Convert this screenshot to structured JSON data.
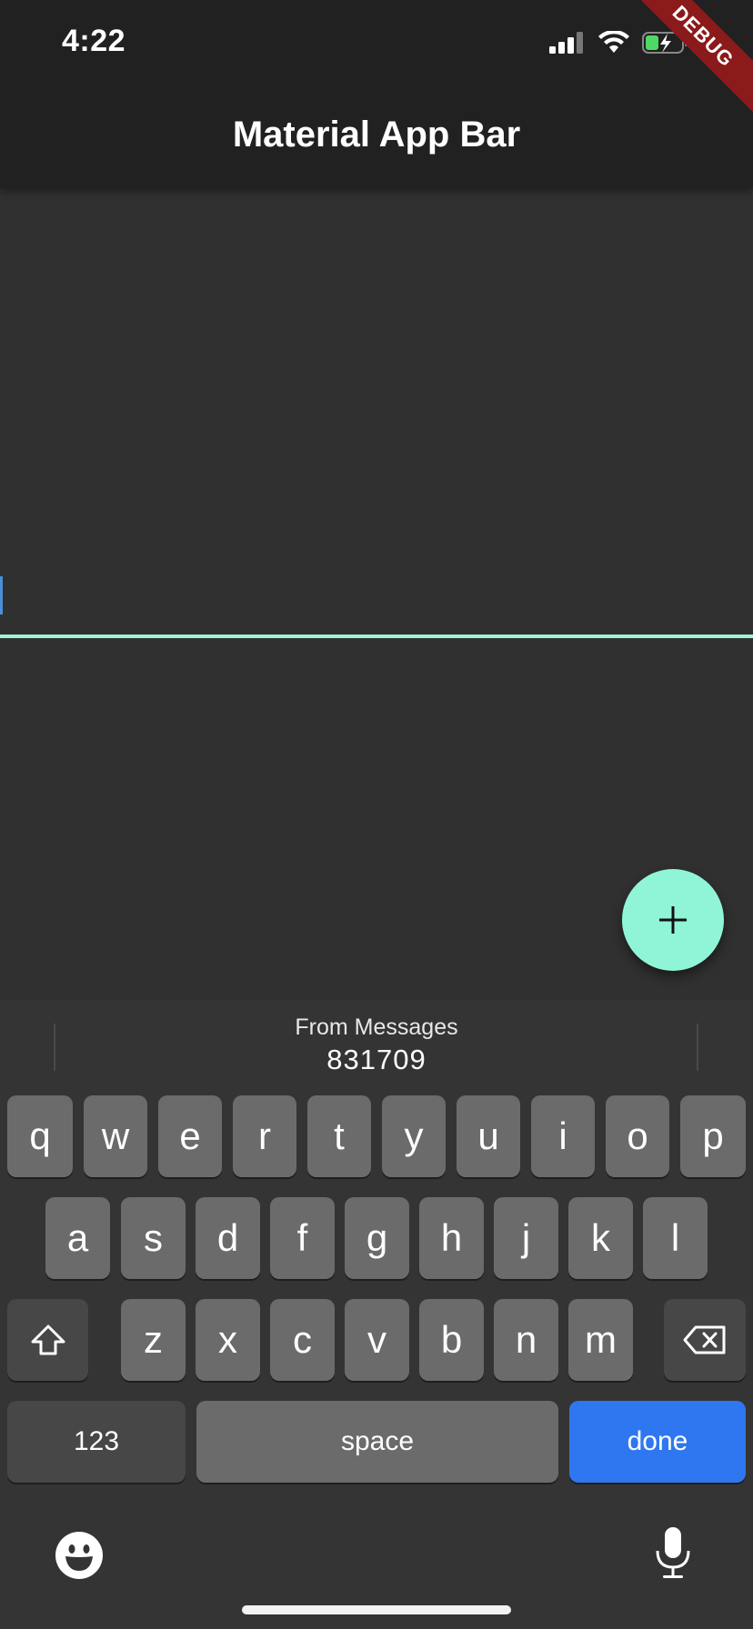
{
  "status_bar": {
    "time": "4:22",
    "icons": [
      "signal-icon",
      "wifi-icon",
      "battery-charging-icon"
    ]
  },
  "debug_banner": "DEBUG",
  "app_bar": {
    "title": "Material App Bar"
  },
  "fab": {
    "icon": "plus-icon",
    "label": "+"
  },
  "keyboard": {
    "suggestion": {
      "label": "From Messages",
      "code": "831709"
    },
    "row1": [
      "q",
      "w",
      "e",
      "r",
      "t",
      "y",
      "u",
      "i",
      "o",
      "p"
    ],
    "row2": [
      "a",
      "s",
      "d",
      "f",
      "g",
      "h",
      "j",
      "k",
      "l"
    ],
    "row3": [
      "z",
      "x",
      "c",
      "v",
      "b",
      "n",
      "m"
    ],
    "shift_icon": "shift-icon",
    "backspace_icon": "backspace-icon",
    "numbers_label": "123",
    "space_label": "space",
    "done_label": "done",
    "emoji_icon": "emoji-icon",
    "mic_icon": "microphone-icon"
  },
  "colors": {
    "accent": "#9ff2da",
    "fab": "#8ff5d6",
    "done_key": "#2f77f0",
    "app_bar": "#212121",
    "background": "#303030"
  }
}
